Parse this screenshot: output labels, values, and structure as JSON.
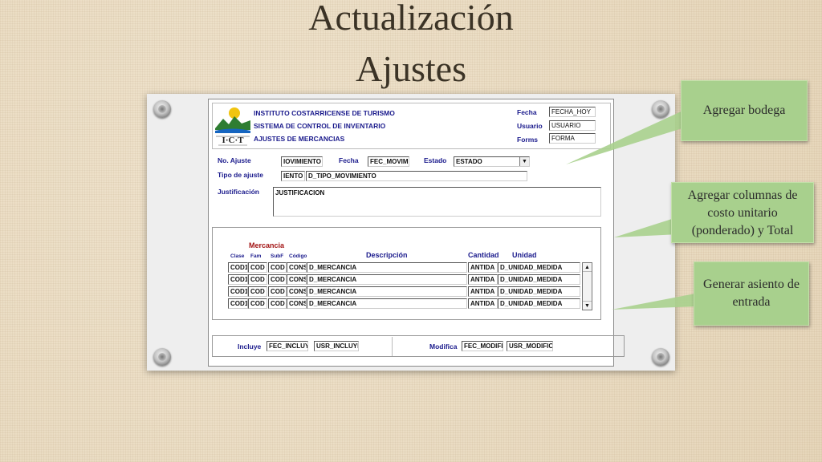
{
  "slide": {
    "title_line1": "Actualización",
    "title_line2": "Ajustes"
  },
  "form": {
    "header": {
      "org_line1": "INSTITUTO COSTARRICENSE DE TURISMO",
      "org_line2": "SISTEMA DE CONTROL DE INVENTARIO",
      "org_line3": "AJUSTES DE MERCANCIAS",
      "logo_text": "I·C·T",
      "fecha_label": "Fecha",
      "fecha_value": "FECHA_HOY",
      "usuario_label": "Usuario",
      "usuario_value": "USUARIO",
      "forms_label": "Forms",
      "forms_value": "FORMA"
    },
    "no_ajuste": {
      "label": "No. Ajuste",
      "value": "IOVIMIENTO"
    },
    "fecha": {
      "label": "Fecha",
      "value": "FEC_MOVIM"
    },
    "estado": {
      "label": "Estado",
      "value": "ESTADO"
    },
    "tipo_ajuste": {
      "label": "Tipo de ajuste",
      "code": "IENTO",
      "value": "D_TIPO_MOVIMIENTO"
    },
    "justificacion": {
      "label": "Justificación",
      "value": "JUSTIFICACION"
    },
    "mercancia": {
      "section_label": "Mercancia",
      "columns": {
        "clase": "Clase",
        "fam": "Fam",
        "subf": "SubF",
        "codigo": "Código",
        "descripcion": "Descripción",
        "cantidad": "Cantidad",
        "unidad": "Unidad"
      },
      "rows": [
        {
          "clase": "COD1",
          "fam": "COD",
          "subf": "COD",
          "codigo": "CONS",
          "descripcion": "D_MERCANCIA",
          "cantidad": "ANTIDA",
          "unidad": "D_UNIDAD_MEDIDA"
        },
        {
          "clase": "COD1",
          "fam": "COD",
          "subf": "COD",
          "codigo": "CONS",
          "descripcion": "D_MERCANCIA",
          "cantidad": "ANTIDA",
          "unidad": "D_UNIDAD_MEDIDA"
        },
        {
          "clase": "COD1",
          "fam": "COD",
          "subf": "COD",
          "codigo": "CONS",
          "descripcion": "D_MERCANCIA",
          "cantidad": "ANTIDA",
          "unidad": "D_UNIDAD_MEDIDA"
        },
        {
          "clase": "COD1",
          "fam": "COD",
          "subf": "COD",
          "codigo": "CONS",
          "descripcion": "D_MERCANCIA",
          "cantidad": "ANTIDA",
          "unidad": "D_UNIDAD_MEDIDA"
        }
      ]
    },
    "footer": {
      "incluye_label": "Incluye",
      "incluye_fecha": "FEC_INCLUY",
      "incluye_usuario": "USR_INCLUYI",
      "modifica_label": "Modifica",
      "modifica_fecha": "FEC_MODIFI",
      "modifica_usuario": "USR_MODIFIC"
    }
  },
  "callouts": [
    {
      "text": "Agregar bodega"
    },
    {
      "text": "Agregar columnas de costo unitario (ponderado) y Total"
    },
    {
      "text": "Generar asiento de entrada"
    }
  ],
  "colors": {
    "label_blue": "#1a1a8c",
    "mercancia_red": "#a31515",
    "callout_green": "#a8d08d"
  }
}
